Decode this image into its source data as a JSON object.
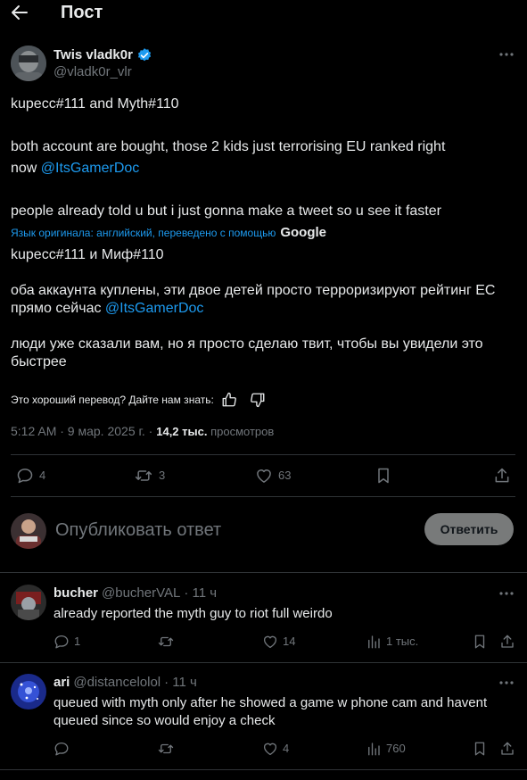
{
  "header": {
    "title": "Пост"
  },
  "post": {
    "author_name": "Twis vladk0r",
    "author_handle": "@vladk0r_vlr",
    "original": {
      "line1": "kupecc#111 and Myth#110",
      "line2a": "both account are bought, those 2 kids just terrorising EU ranked right",
      "line2b": "now ",
      "mention": "@ItsGamerDoc",
      "line3": "people already told u but i just gonna make a tweet so u see it faster"
    },
    "translation_notice": "Язык оригинала: английский, переведено с помощью",
    "translation_brand": "Google",
    "translated": {
      "line1": "kupecc#111 и Миф#110",
      "line2a": "оба аккаунта куплены, эти двое детей просто терроризируют рейтинг ЕС",
      "line2b": "прямо сейчас ",
      "mention": "@ItsGamerDoc",
      "line3a": "люди уже сказали вам, но я просто сделаю твит, чтобы вы увидели это",
      "line3b": "быстрее"
    },
    "feedback_prompt": "Это хороший перевод? Дайте нам знать:",
    "timestamp": "5:12 AM · 9 мар. 2025 г. · ",
    "views_count": "14,2 тыс.",
    "views_label": " просмотров",
    "stats": {
      "replies": "4",
      "reposts": "3",
      "likes": "63"
    }
  },
  "compose": {
    "placeholder": "Опубликовать ответ",
    "reply_button": "Ответить"
  },
  "replies": [
    {
      "name": "bucher",
      "handle": "@bucherVAL",
      "time": "· 11 ч",
      "text_lines": [
        "already reported the myth guy to riot full weirdo"
      ],
      "stats": {
        "replies": "1",
        "reposts": "",
        "likes": "14",
        "views": "1 тыс."
      }
    },
    {
      "name": "ari",
      "handle": "@distancelolol",
      "time": "· 11 ч",
      "text_lines": [
        "queued with myth only after he showed a game w phone cam and havent",
        "queued since so would enjoy a check"
      ],
      "stats": {
        "replies": "",
        "reposts": "",
        "likes": "4",
        "views": "760"
      }
    }
  ],
  "colors": {
    "background": "#000000",
    "accent": "#1d9bf0",
    "text": "#e7e9ea",
    "muted": "#71767b",
    "divider": "#2f3336",
    "button_bg": "#787a7a"
  }
}
